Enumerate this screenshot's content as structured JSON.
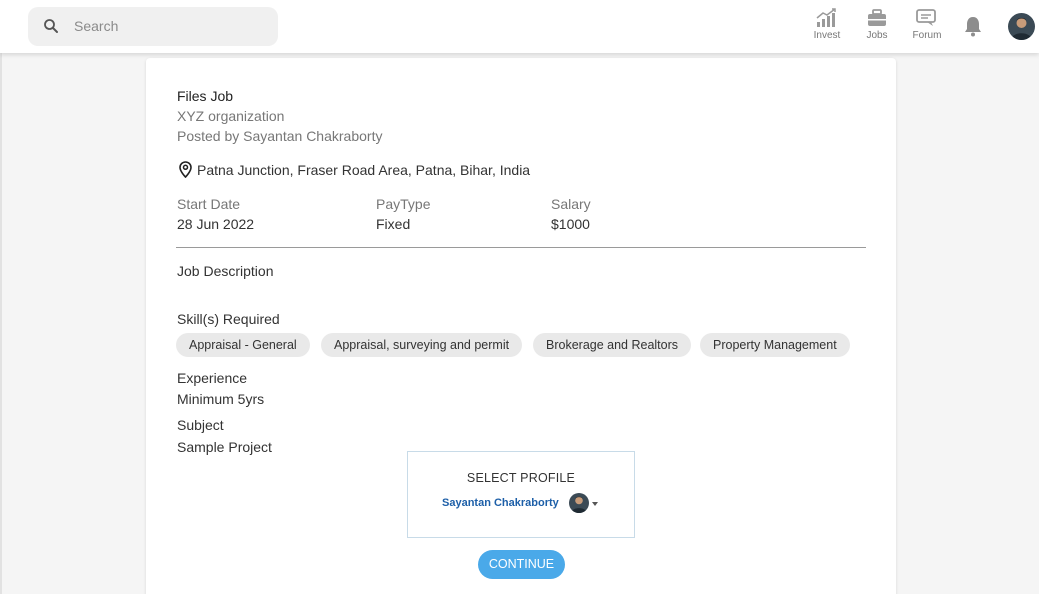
{
  "header": {
    "search": {
      "placeholder": "Search",
      "value": ""
    },
    "nav": [
      {
        "label": "Invest",
        "icon": "chart-bars-icon"
      },
      {
        "label": "Jobs",
        "icon": "briefcase-icon"
      },
      {
        "label": "Forum",
        "icon": "chat-icon"
      }
    ],
    "notifications_icon": "bell-icon",
    "avatar_icon": "user-avatar"
  },
  "job": {
    "title": "Files Job",
    "organization": "XYZ organization",
    "posted_by": "Posted by Sayantan Chakraborty",
    "location": "Patna Junction, Fraser Road Area, Patna, Bihar, India",
    "details": [
      {
        "label": "Start Date",
        "value": "28 Jun 2022"
      },
      {
        "label": "PayType",
        "value": "Fixed"
      },
      {
        "label": "Salary",
        "value": "$1000"
      }
    ],
    "description_label": "Job Description",
    "skills_label": "Skill(s) Required",
    "skills": [
      "Appraisal - General",
      "Appraisal, surveying and permit",
      "Brokerage and Realtors",
      "Property Management"
    ],
    "experience_label": "Experience",
    "experience_value": "Minimum 5yrs",
    "subject_label": "Subject",
    "subject_value": "Sample Project"
  },
  "profile_select": {
    "title": "SELECT PROFILE",
    "name": "Sayantan Chakraborty"
  },
  "continue_label": "CONTINUE",
  "colors": {
    "accent": "#4aa9e9",
    "profile_name": "#1d5fa8"
  }
}
